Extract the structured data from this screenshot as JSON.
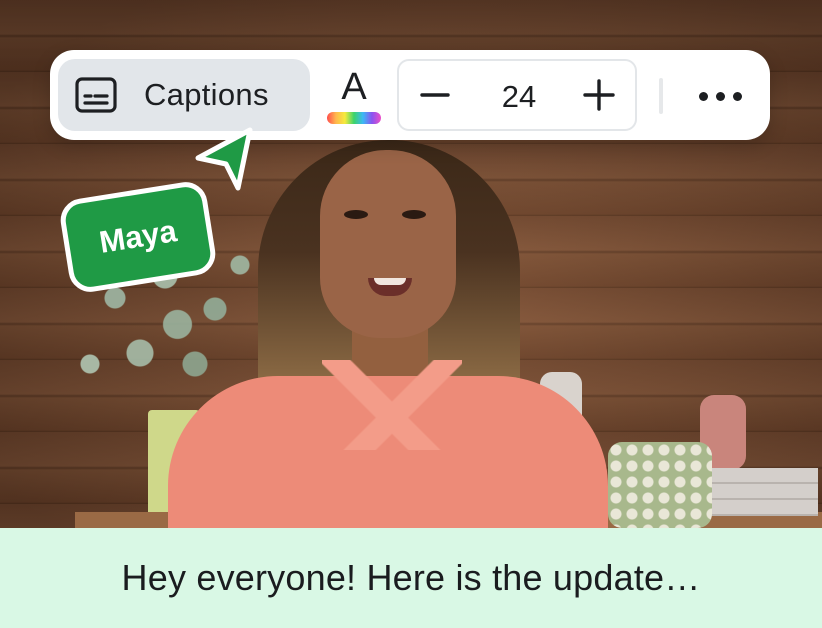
{
  "toolbar": {
    "captions_label": "Captions",
    "color_letter": "A",
    "font_size": "24",
    "minus_symbol": "−",
    "plus_symbol": "+"
  },
  "collaborator": {
    "name": "Maya",
    "color": "#1f9a45"
  },
  "caption": {
    "text": "Hey everyone! Here is the update…",
    "background": "#d9f8e5"
  },
  "icons": [
    "captions-icon",
    "text-color-icon",
    "minus-icon",
    "plus-icon",
    "more-horizontal-icon",
    "cursor-pointer-icon"
  ]
}
